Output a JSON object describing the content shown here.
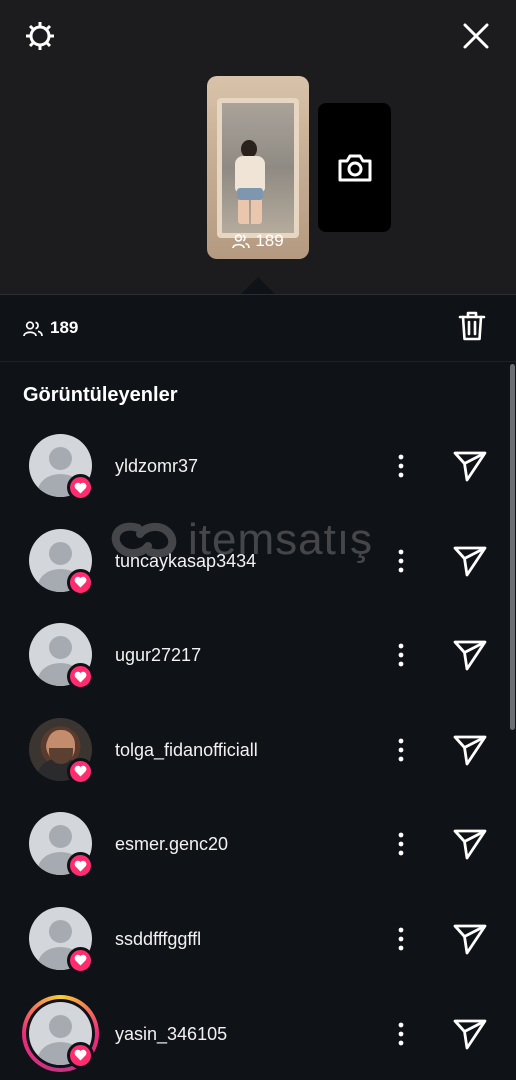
{
  "top": {
    "story_viewers_count": "189",
    "icons": [
      "settings-icon",
      "close-icon",
      "camera-icon",
      "viewers-icon"
    ]
  },
  "sheet": {
    "viewers_count": "189",
    "delete_icon": "trash-icon"
  },
  "section_title": "Görüntüleyenler",
  "watermark": "itemsatış",
  "viewers": [
    {
      "username": "yldzomr37",
      "avatar": "default",
      "liked": true
    },
    {
      "username": "tuncaykasap3434",
      "avatar": "default",
      "liked": true
    },
    {
      "username": "ugur27217",
      "avatar": "default",
      "liked": true
    },
    {
      "username": "tolga_fidanofficiall",
      "avatar": "photo",
      "liked": true
    },
    {
      "username": "esmer.genc20",
      "avatar": "default",
      "liked": true
    },
    {
      "username": "ssddfffggffl",
      "avatar": "default",
      "liked": true
    },
    {
      "username": "yasin_346105",
      "avatar": "default-story-ring",
      "liked": true
    }
  ],
  "colors": {
    "background": "#0f1217",
    "top_background": "#1c1c1e",
    "heart_badge": "#ff2d6f"
  }
}
